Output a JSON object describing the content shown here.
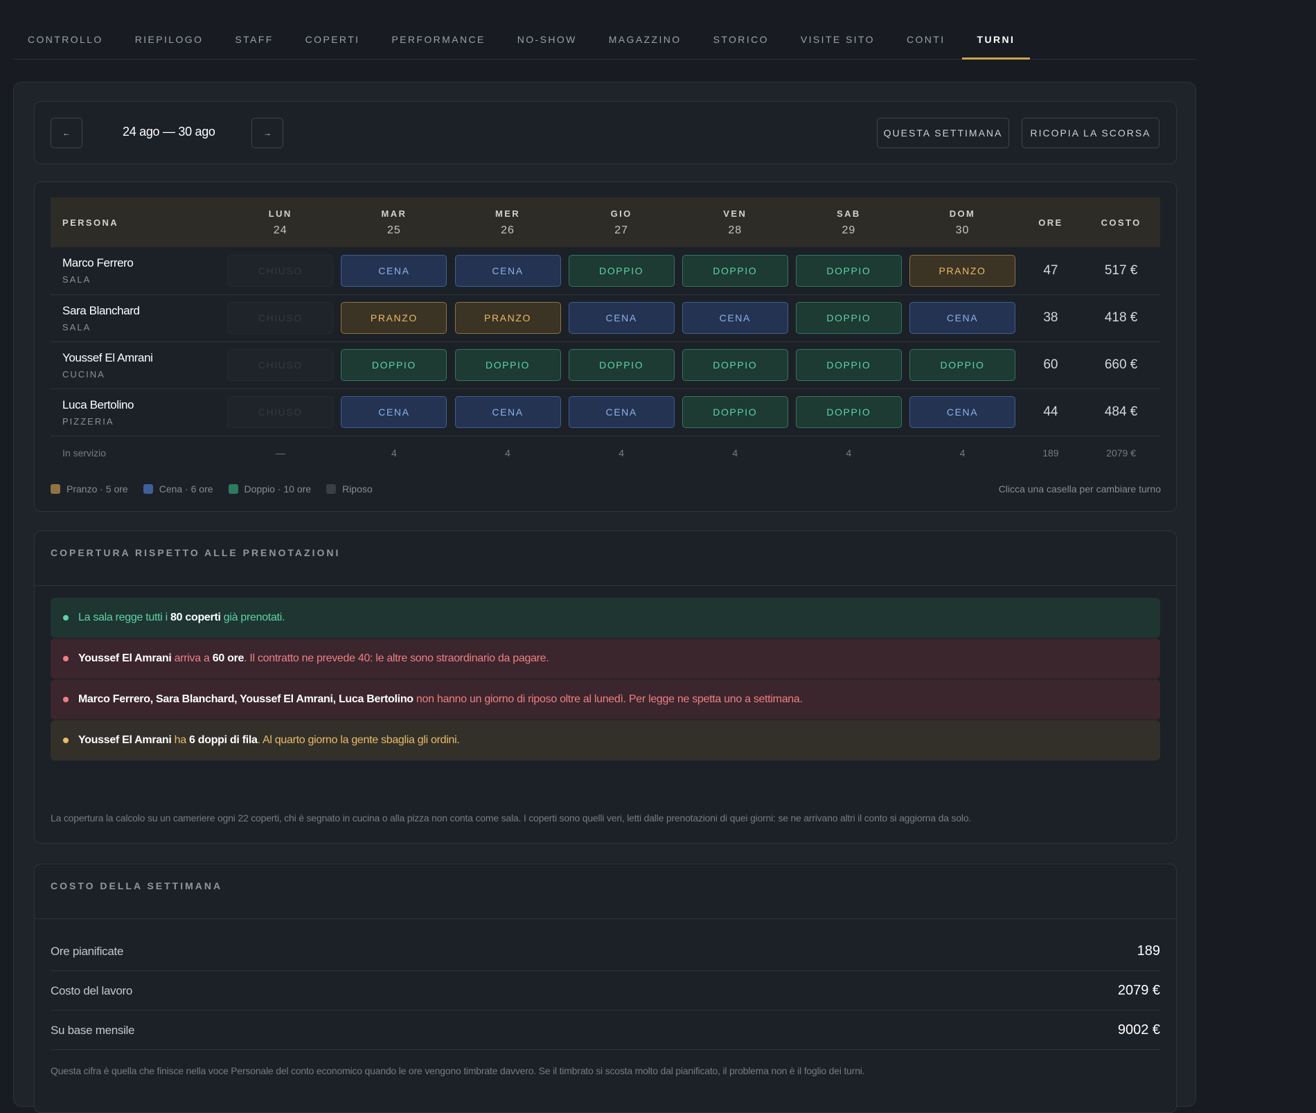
{
  "tabs": [
    "CONTROLLO",
    "RIEPILOGO",
    "STAFF",
    "COPERTI",
    "PERFORMANCE",
    "NO-SHOW",
    "MAGAZZINO",
    "STORICO",
    "VISITE SITO",
    "CONTI",
    "TURNI"
  ],
  "active_tab": "TURNI",
  "week": {
    "prev_icon": "arrow-left-icon",
    "prev_label": "←",
    "range": "24 ago — 30 ago",
    "next_icon": "arrow-right-icon",
    "next_label": "→",
    "this_week_label": "QUESTA SETTIMANA",
    "copy_last_label": "RICOPIA LA SCORSA"
  },
  "schedule": {
    "header": {
      "person": "PERSONA",
      "days": [
        {
          "name": "LUN",
          "num": "24"
        },
        {
          "name": "MAR",
          "num": "25"
        },
        {
          "name": "MER",
          "num": "26"
        },
        {
          "name": "GIO",
          "num": "27"
        },
        {
          "name": "VEN",
          "num": "28"
        },
        {
          "name": "SAB",
          "num": "29"
        },
        {
          "name": "DOM",
          "num": "30"
        }
      ],
      "hours": "ORE",
      "cost": "COSTO"
    },
    "rows": [
      {
        "name": "Marco Ferrero",
        "role": "SALA",
        "shifts": [
          "CHIUSO",
          "CENA",
          "CENA",
          "DOPPIO",
          "DOPPIO",
          "DOPPIO",
          "PRANZO"
        ],
        "hours": "47",
        "cost": "517 €"
      },
      {
        "name": "Sara Blanchard",
        "role": "SALA",
        "shifts": [
          "CHIUSO",
          "PRANZO",
          "PRANZO",
          "CENA",
          "CENA",
          "DOPPIO",
          "CENA"
        ],
        "hours": "38",
        "cost": "418 €"
      },
      {
        "name": "Youssef El Amrani",
        "role": "CUCINA",
        "shifts": [
          "CHIUSO",
          "DOPPIO",
          "DOPPIO",
          "DOPPIO",
          "DOPPIO",
          "DOPPIO",
          "DOPPIO"
        ],
        "hours": "60",
        "cost": "660 €"
      },
      {
        "name": "Luca Bertolino",
        "role": "PIZZERIA",
        "shifts": [
          "CHIUSO",
          "CENA",
          "CENA",
          "CENA",
          "DOPPIO",
          "DOPPIO",
          "CENA"
        ],
        "hours": "44",
        "cost": "484 €"
      }
    ],
    "footer": {
      "label": "In servizio",
      "values": [
        "—",
        "4",
        "4",
        "4",
        "4",
        "4",
        "4"
      ],
      "hours": "189",
      "cost": "2079 €"
    }
  },
  "legend": [
    {
      "label": "Pranzo · 5 ore",
      "color": "#8f7440"
    },
    {
      "label": "Cena · 6 ore",
      "color": "#3f5f98"
    },
    {
      "label": "Doppio · 10 ore",
      "color": "#2e7a5f"
    },
    {
      "label": "Riposo",
      "color": "#3a3f47"
    }
  ],
  "hint": "Clicca una casella per cambiare turno",
  "coverage": {
    "title": "COPERTURA RISPETTO ALLE PRENOTAZIONI",
    "alerts": [
      {
        "kind": "green",
        "parts": [
          {
            "t": "La sala regge tutti i "
          },
          {
            "t": "80 coperti",
            "b": true
          },
          {
            "t": " già prenotati."
          }
        ]
      },
      {
        "kind": "red",
        "parts": [
          {
            "t": "Youssef El Amrani",
            "b": true
          },
          {
            "t": " arriva a "
          },
          {
            "t": "60 ore",
            "b": true
          },
          {
            "t": ". Il contratto ne prevede 40: le altre sono straordinario da pagare."
          }
        ]
      },
      {
        "kind": "red",
        "parts": [
          {
            "t": "Marco Ferrero, Sara Blanchard, Youssef El Amrani, Luca Bertolino",
            "b": true
          },
          {
            "t": " non hanno un giorno di riposo oltre al lunedì. Per legge ne spetta uno a settimana."
          }
        ]
      },
      {
        "kind": "yellow",
        "parts": [
          {
            "t": "Youssef El Amrani",
            "b": true
          },
          {
            "t": " ha "
          },
          {
            "t": "6 doppi di fila",
            "b": true
          },
          {
            "t": ". Al quarto giorno la gente sbaglia gli ordini."
          }
        ]
      }
    ],
    "note": "La copertura la calcolo su un cameriere ogni 22 coperti, chi è segnato in cucina o alla pizza non conta come sala. I coperti sono quelli veri, letti dalle prenotazioni di quei giorni: se ne arrivano altri il conto si aggiorna da solo."
  },
  "cost": {
    "title": "COSTO DELLA SETTIMANA",
    "rows": [
      {
        "label": "Ore pianificate",
        "value": "189"
      },
      {
        "label": "Costo del lavoro",
        "value": "2079 €"
      },
      {
        "label": "Su base mensile",
        "value": "9002 €"
      }
    ],
    "note": "Questa cifra è quella che finisce nella voce Personale del conto economico quando le ore vengono timbrate davvero. Se il timbrato si scosta molto dal pianificato, il problema non è il foglio dei turni."
  }
}
